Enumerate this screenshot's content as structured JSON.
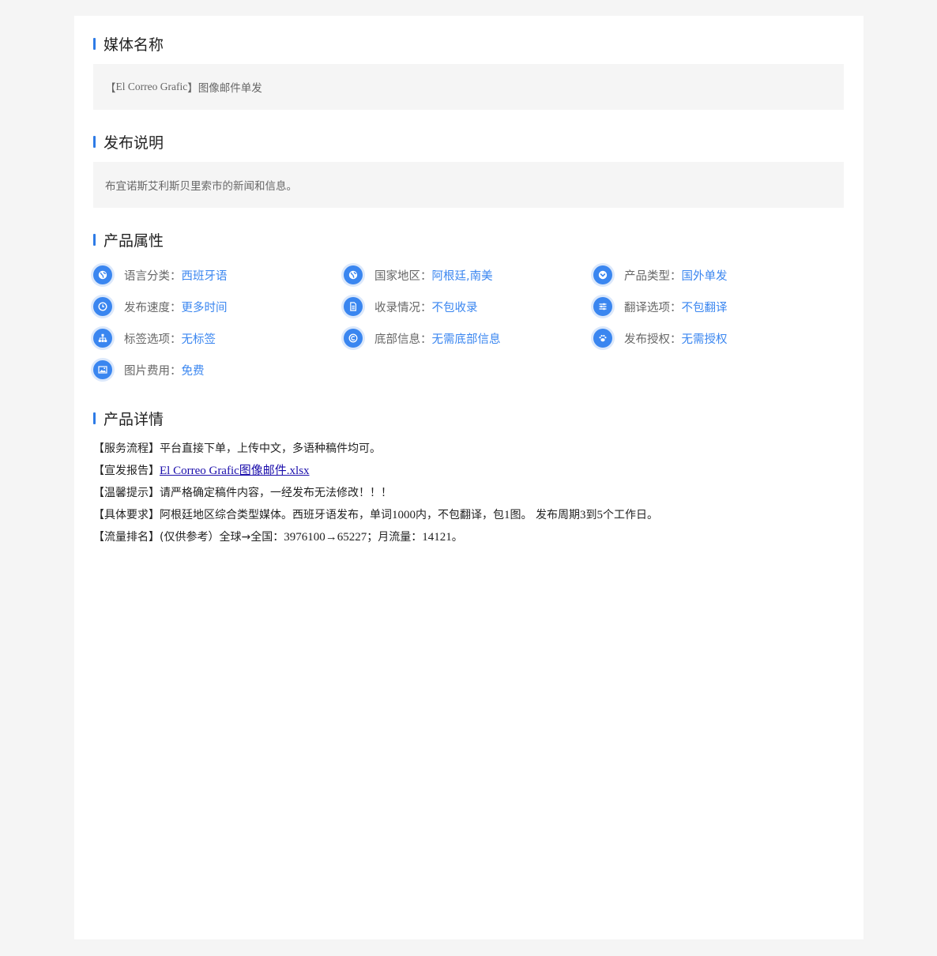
{
  "sections": {
    "media_name_title": "媒体名称",
    "publish_desc_title": "发布说明",
    "attributes_title": "产品属性",
    "details_title": "产品详情"
  },
  "media_name": {
    "bracket_open": "【",
    "name": "El Correo Grafic",
    "bracket_close": "】",
    "suffix": "图像邮件单发"
  },
  "publish_desc": "布宜诺斯艾利斯贝里索市的新闻和信息。",
  "attributes": [
    {
      "label": "语言分类：",
      "value": "西班牙语",
      "icon": "globe-icon"
    },
    {
      "label": "国家地区：",
      "value": "阿根廷,南美",
      "icon": "globe-icon"
    },
    {
      "label": "产品类型：",
      "value": "国外单发",
      "icon": "chevron-down-circle-icon"
    },
    {
      "label": "发布速度：",
      "value": "更多时间",
      "icon": "clock-icon"
    },
    {
      "label": "收录情况：",
      "value": "不包收录",
      "icon": "document-icon"
    },
    {
      "label": "翻译选项：",
      "value": "不包翻译",
      "icon": "sliders-icon"
    },
    {
      "label": "标签选项：",
      "value": "无标签",
      "icon": "sitemap-icon"
    },
    {
      "label": "底部信息：",
      "value": "无需底部信息",
      "icon": "copyright-icon"
    },
    {
      "label": "发布授权：",
      "value": "无需授权",
      "icon": "paw-icon"
    },
    {
      "label": "图片费用：",
      "value": "免费",
      "icon": "image-icon"
    }
  ],
  "details": {
    "service_flow": "【服务流程】平台直接下单，上传中文，多语种稿件均可。",
    "report_label": "【宣发报告】",
    "report_link": "El Correo Grafic图像邮件.xlsx",
    "tip": "【温馨提示】请严格确定稿件内容，一经发布无法修改！！！",
    "req_a": "【具体要求】阿根廷地区综合类型媒体。西班牙语发布，单词",
    "req_words": "1000",
    "req_b": "内，不包翻译，包",
    "req_pics": "1",
    "req_c": "图。 发布周期",
    "req_days_from": "3",
    "req_d": "到",
    "req_days_to": "5",
    "req_e": "个工作日。",
    "traffic_a": "【流量排名】(仅供参考）全球→全国：",
    "traffic_global": "3976100",
    "traffic_arrow": "→",
    "traffic_national": "65227",
    "traffic_b": "；月流量：",
    "traffic_monthly": "14121",
    "traffic_c": "。"
  },
  "colors": {
    "accent": "#2e7be6",
    "link": "#3a86f0",
    "icon_halo": "#dbe8fb",
    "page_bg": "#f5f5f5",
    "box_bg": "#f5f5f5"
  }
}
